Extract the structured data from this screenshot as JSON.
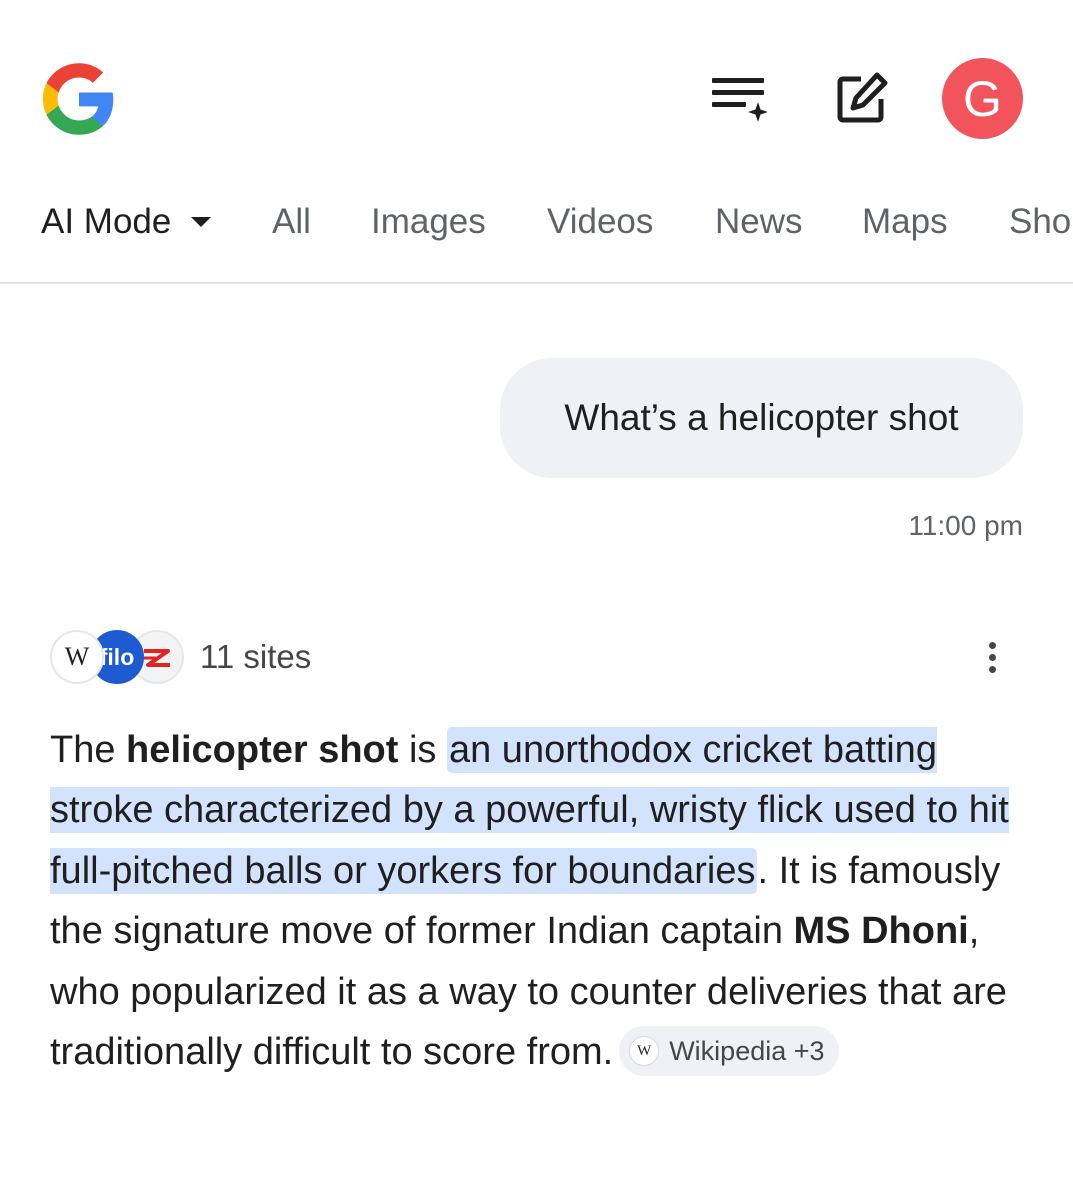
{
  "header": {
    "logo_icon": "google-g-icon",
    "history_icon": "ai-mode-history-icon",
    "new_chat_icon": "new-chat-icon",
    "avatar_letter": "G",
    "avatar_color": "#f2545b"
  },
  "tabs": {
    "ai_mode": "AI Mode",
    "all": "All",
    "images": "Images",
    "videos": "Videos",
    "news": "News",
    "maps": "Maps",
    "shopping": "Sho"
  },
  "query": {
    "text": "What’s a helicopter shot",
    "time": "11:00 pm"
  },
  "sources": {
    "favicon_1": "W",
    "favicon_2": "filo",
    "favicon_3_icon": "z-logo-icon",
    "count": "11 sites"
  },
  "answer": {
    "t1": "The ",
    "b1": "helicopter shot",
    "t2": " is ",
    "h1": "an unorthodox cricket batting stroke characterized by a powerful, wristy flick used to hit full-pitched balls or yorkers for boundaries",
    "t3": ". It is famously the signature move of former Indian captain ",
    "b2": "MS Dhoni",
    "t4": ", who popularized it as a way to counter deliveries that are traditionally difficult to score from.",
    "citation_icon": "W",
    "citation_label": "Wikipedia +3"
  },
  "colors": {
    "highlight": "#d3e3fd",
    "bubble": "#eff1f5",
    "accent": "#1e5bd1"
  }
}
